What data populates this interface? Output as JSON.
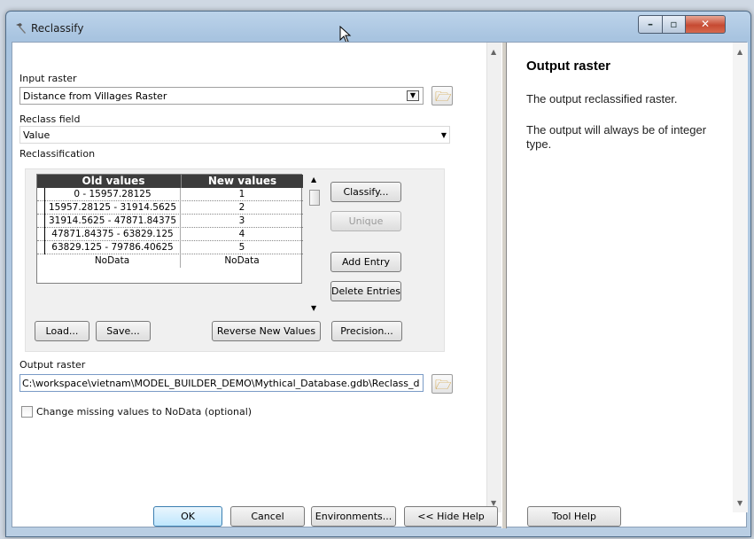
{
  "window": {
    "title": "Reclassify"
  },
  "form": {
    "input_raster_label": "Input raster",
    "input_raster_value": "Distance from Villages Raster",
    "reclass_field_label": "Reclass field",
    "reclass_field_value": "Value",
    "reclassification_label": "Reclassification",
    "table": {
      "headers": [
        "Old values",
        "New values"
      ],
      "rows": [
        {
          "old": "0 - 15957.28125",
          "new": "1"
        },
        {
          "old": "15957.28125 - 31914.5625",
          "new": "2"
        },
        {
          "old": "31914.5625 - 47871.84375",
          "new": "3"
        },
        {
          "old": "47871.84375 - 63829.125",
          "new": "4"
        },
        {
          "old": "63829.125 - 79786.40625",
          "new": "5"
        },
        {
          "old": "NoData",
          "new": "NoData"
        }
      ]
    },
    "side_buttons": {
      "classify": "Classify...",
      "unique": "Unique",
      "add_entry": "Add Entry",
      "delete_entries": "Delete Entries"
    },
    "lower_buttons": {
      "load": "Load...",
      "save": "Save...",
      "reverse": "Reverse New Values",
      "precision": "Precision..."
    },
    "output_raster_label": "Output raster",
    "output_raster_value": "C:\\workspace\\vietnam\\MODEL_BUILDER_DEMO\\Mythical_Database.gdb\\Reclass_d",
    "missing_values_label": "Change missing values to NoData (optional)",
    "missing_values_checked": false
  },
  "help": {
    "title": "Output raster",
    "paragraph1": "The output reclassified raster.",
    "paragraph2": "The output will always be of integer type."
  },
  "footer": {
    "ok": "OK",
    "cancel": "Cancel",
    "environments": "Environments...",
    "hide_help": "<< Hide Help",
    "tool_help": "Tool Help"
  },
  "icons": {
    "app_icon": "hammer-icon",
    "folder": "open-folder-icon",
    "minimize": "minimize-icon",
    "maximize": "maximize-icon",
    "close": "close-icon",
    "cursor": "mouse-pointer-icon"
  },
  "colors": {
    "title_bar": "#a8c4e0",
    "close_button": "#c64a32",
    "grid_header": "#3c3c3c",
    "primary_button": "#bee6fd"
  }
}
